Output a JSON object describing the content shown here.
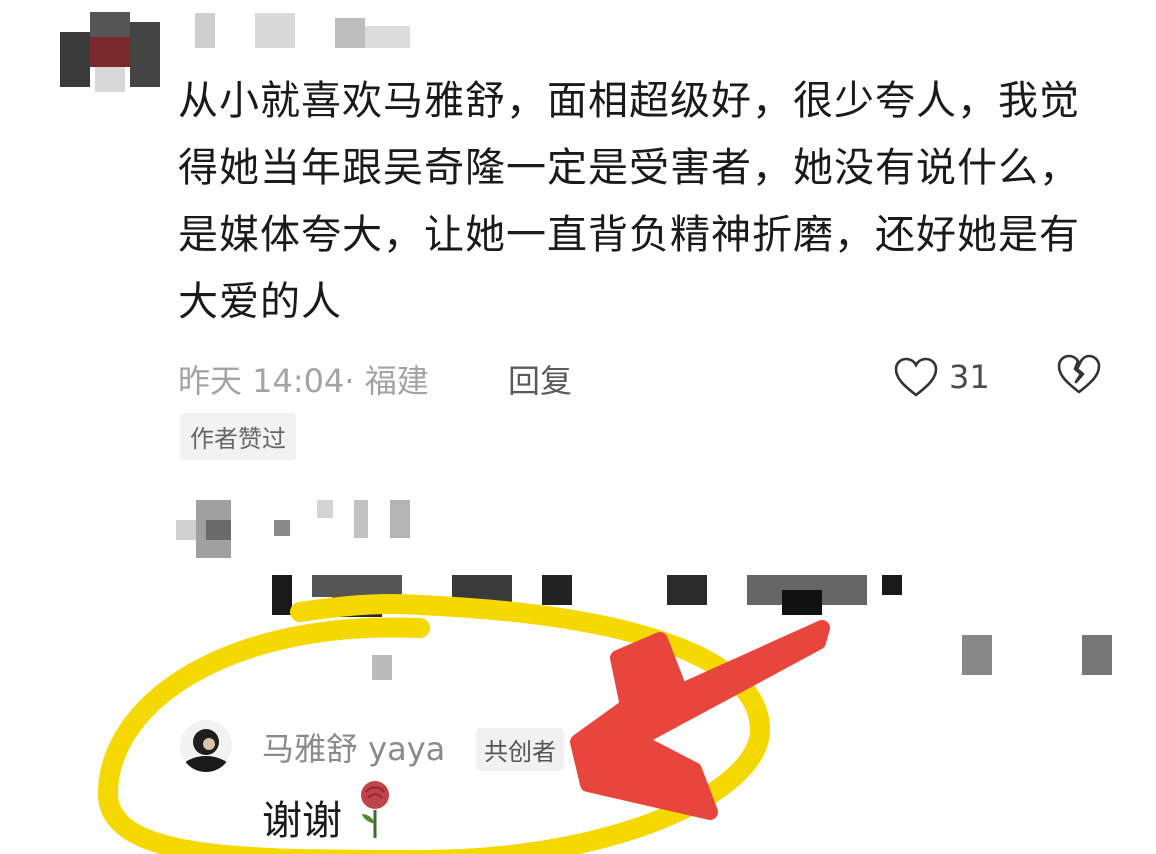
{
  "comment": {
    "text": "从小就喜欢马雅舒，面相超级好，很少夸人，我觉得她当年跟吴奇隆一定是受害者，她没有说什么，是媒体夸大，让她一直背负精神折磨，还好她是有大爱的人",
    "time_location": "昨天 14:04· 福建",
    "reply_label": "回复",
    "like_count": "31",
    "author_liked_badge": "作者赞过"
  },
  "author_reply": {
    "name": "马雅舒 yaya",
    "badge": "共创者",
    "text": "谢谢"
  },
  "icons": {
    "like": "heart-outline-icon",
    "dislike": "broken-heart-icon",
    "reply_emoji": "rose-icon"
  },
  "colors": {
    "highlight_circle": "#f5d800",
    "arrow": "#e8453c",
    "text_primary": "#1a1a1a",
    "text_meta": "#a3a3a3"
  }
}
